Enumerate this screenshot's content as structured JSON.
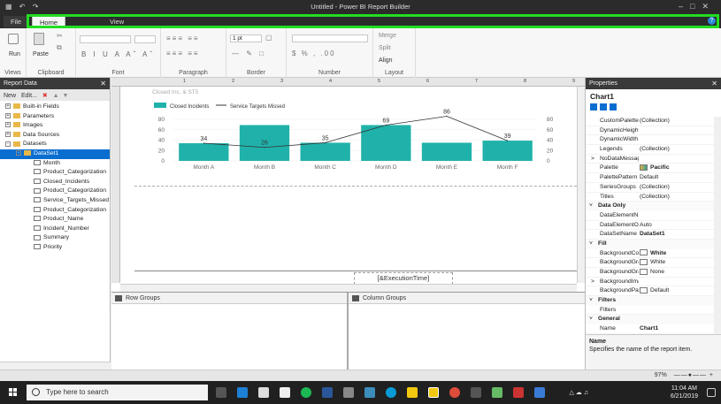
{
  "window": {
    "title": "Untitled - Power BI Report Builder"
  },
  "tabs": {
    "file": "File",
    "home": "Home",
    "view": "View"
  },
  "ribbon": {
    "groups": [
      "Views",
      "Clipboard",
      "Font",
      "Paragraph",
      "Border",
      "Number",
      "Layout"
    ],
    "run_label": "Run",
    "paste_label": "Paste",
    "border_size": "1 pt",
    "merge": "Merge",
    "split": "Split",
    "align": "Align"
  },
  "report_data": {
    "title": "Report Data",
    "toolbar": {
      "new": "New",
      "edit": "Edit..."
    },
    "tree": [
      {
        "label": "Built-in Fields",
        "type": "folder"
      },
      {
        "label": "Parameters",
        "type": "folder"
      },
      {
        "label": "Images",
        "type": "folder"
      },
      {
        "label": "Data Sources",
        "type": "folder"
      },
      {
        "label": "Datasets",
        "type": "folder"
      },
      {
        "label": "DataSet1",
        "type": "dataset"
      },
      {
        "label": "Month",
        "type": "field"
      },
      {
        "label": "Product_Categorization",
        "type": "field"
      },
      {
        "label": "Closed_Incidents",
        "type": "field"
      },
      {
        "label": "Product_Categorization",
        "type": "field"
      },
      {
        "label": "Service_Targets_Missed",
        "type": "field"
      },
      {
        "label": "Product_Categorization",
        "type": "field"
      },
      {
        "label": "Product_Name",
        "type": "field"
      },
      {
        "label": "Incident_Number",
        "type": "field"
      },
      {
        "label": "Summary",
        "type": "field"
      },
      {
        "label": "Priority",
        "type": "field"
      }
    ]
  },
  "report": {
    "header_text": "Closed Inc. & ST5",
    "execution_time": "[&ExecutionTime]"
  },
  "chart_data": {
    "type": "bar",
    "categories": [
      "Month A",
      "Month B",
      "Month C",
      "Month D",
      "Month E",
      "Month F"
    ],
    "series": [
      {
        "name": "Closed Incidents",
        "type": "bar",
        "color": "#20b2aa",
        "values": [
          34,
          69,
          35,
          69,
          35,
          39
        ]
      },
      {
        "name": "Service Targets Missed",
        "type": "line",
        "color": "#333333",
        "values": [
          34,
          26,
          35,
          69,
          86,
          39
        ]
      }
    ],
    "data_labels": [
      "34",
      "26",
      "35",
      "69",
      "86",
      "39"
    ],
    "yticks_left": [
      "80",
      "60",
      "40",
      "20",
      "0"
    ],
    "yticks_right": [
      "80",
      "60",
      "40",
      "20",
      "0"
    ],
    "ylim": [
      0,
      80
    ],
    "legend": "top-left"
  },
  "groups": {
    "row": "Row Groups",
    "column": "Column Groups"
  },
  "properties": {
    "title": "Properties",
    "object": "Chart1",
    "rows": [
      {
        "kind": "prop",
        "name": "CustomPalette",
        "value": "(Collection)"
      },
      {
        "kind": "prop",
        "name": "DynamicHeight",
        "value": ""
      },
      {
        "kind": "prop",
        "name": "DynamicWidth",
        "value": ""
      },
      {
        "kind": "prop",
        "name": "Legends",
        "value": "(Collection)"
      },
      {
        "kind": "prop",
        "name": "NoDataMessage",
        "value": "",
        "expand": ">"
      },
      {
        "kind": "prop",
        "name": "Palette",
        "value": "Pacific",
        "swatch": "palette",
        "bold": true
      },
      {
        "kind": "prop",
        "name": "PalettePattern",
        "value": "Default"
      },
      {
        "kind": "prop",
        "name": "SeriesGroups",
        "value": "(Collection)"
      },
      {
        "kind": "prop",
        "name": "Titles",
        "value": "(Collection)"
      },
      {
        "kind": "cat",
        "name": "Data Only"
      },
      {
        "kind": "prop",
        "name": "DataElementName",
        "value": ""
      },
      {
        "kind": "prop",
        "name": "DataElementOutput",
        "value": "Auto"
      },
      {
        "kind": "prop",
        "name": "DataSetName",
        "value": "DataSet1",
        "bold": true
      },
      {
        "kind": "cat",
        "name": "Fill"
      },
      {
        "kind": "prop",
        "name": "BackgroundColor",
        "value": "White",
        "swatch": "white",
        "bold": true
      },
      {
        "kind": "prop",
        "name": "BackgroundGradientEndColor",
        "value": "White",
        "swatch": "white"
      },
      {
        "kind": "prop",
        "name": "BackgroundGradientType",
        "value": "None",
        "swatch": "white"
      },
      {
        "kind": "prop",
        "name": "BackgroundImage",
        "value": "",
        "expand": ">"
      },
      {
        "kind": "prop",
        "name": "BackgroundPatternType",
        "value": "Default",
        "swatch": "white"
      },
      {
        "kind": "cat",
        "name": "Filters"
      },
      {
        "kind": "prop",
        "name": "Filters",
        "value": ""
      },
      {
        "kind": "cat",
        "name": "General"
      },
      {
        "kind": "prop",
        "name": "Name",
        "value": "Chart1",
        "bold": true
      }
    ],
    "desc_title": "Name",
    "desc_text": "Specifies the name of the report item."
  },
  "status": {
    "zoom": "97%"
  },
  "taskbar": {
    "search_placeholder": "Type here to search",
    "time": "11:04 AM",
    "date": "6/21/2019"
  }
}
